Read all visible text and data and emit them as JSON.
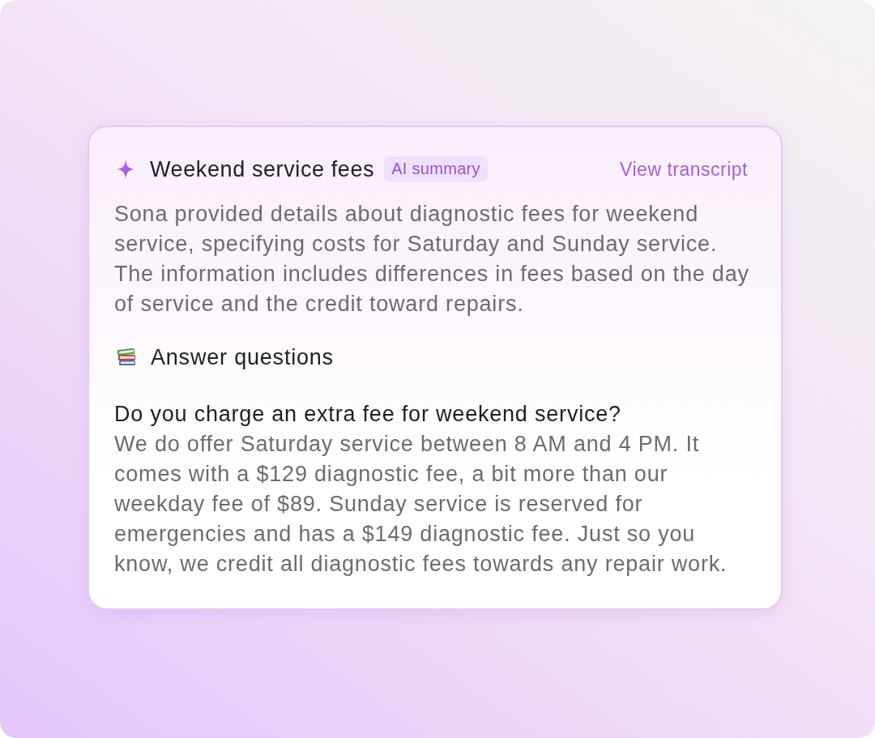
{
  "card": {
    "title": "Weekend service fees",
    "badge": "AI summary",
    "link": "View transcript",
    "summary": "Sona provided details about diagnostic fees for weekend service, specifying costs for Saturday and Sunday service. The information includes differences in fees based on the day of service and the credit toward repairs.",
    "section": {
      "title": "Answer questions"
    },
    "qa": [
      {
        "question": "Do you charge an extra fee for weekend service?",
        "answer": "We do offer Saturday service between 8 AM and 4 PM. It comes with a $129 diagnostic fee, a bit more than our weekday fee of $89. Sunday service is reserved for emergencies and has a $149 diagnostic fee. Just so you know, we credit all diagnostic fees towards any repair work."
      }
    ]
  }
}
